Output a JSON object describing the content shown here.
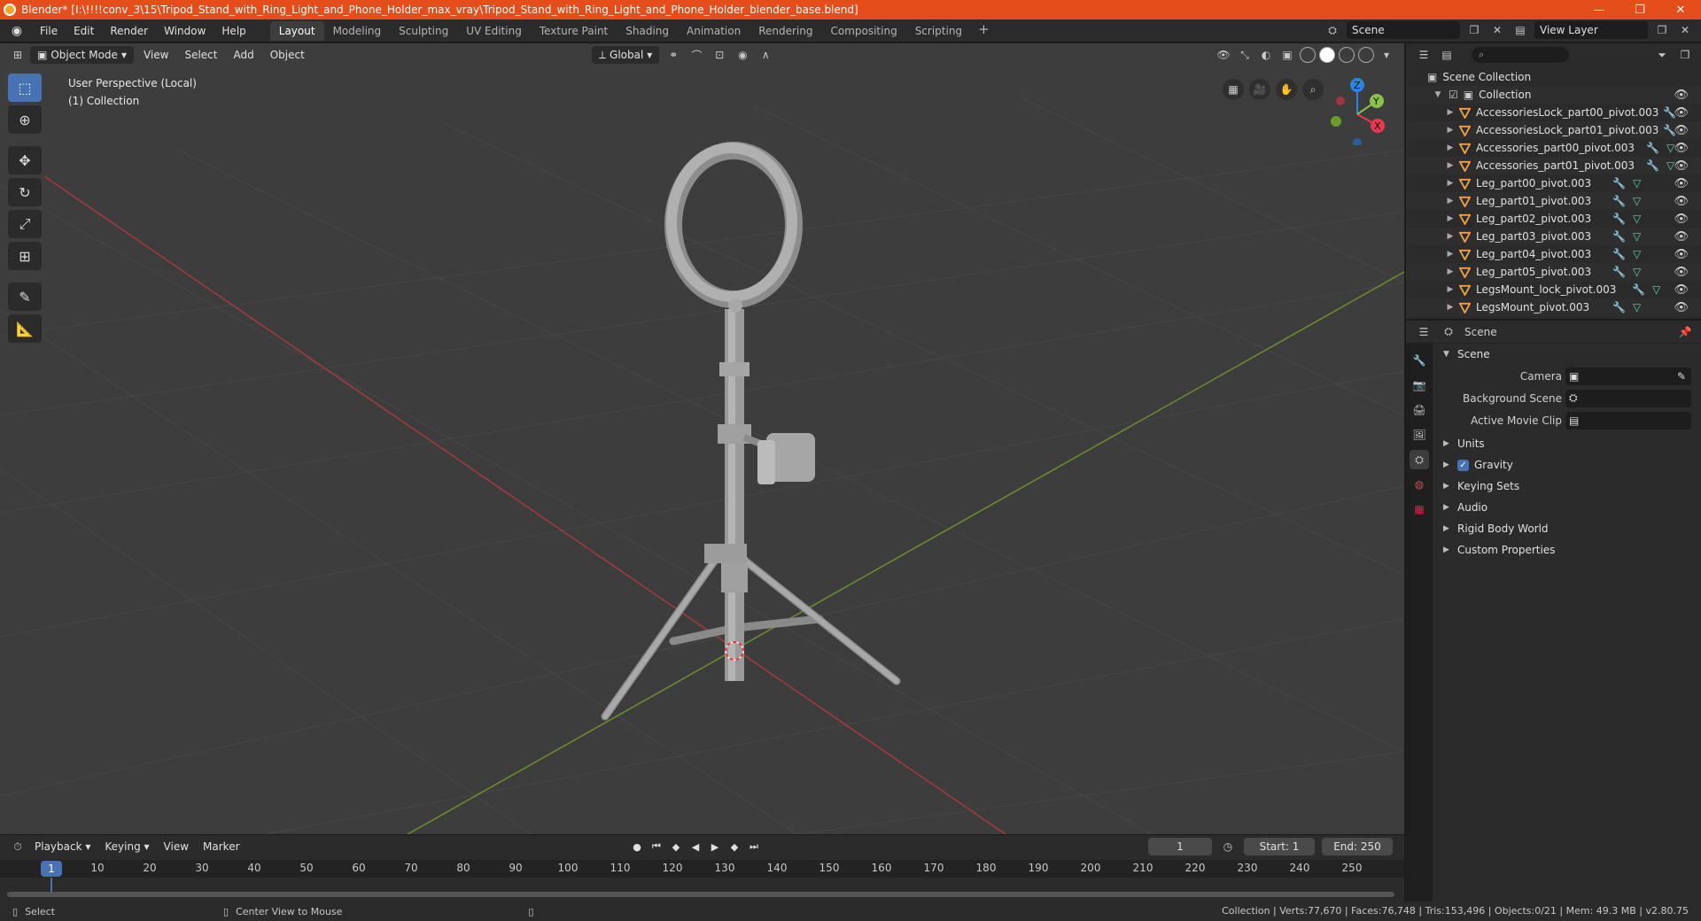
{
  "titlebar": {
    "title": "Blender* [I:\\!!!!conv_3\\15\\Tripod_Stand_with_Ring_Light_and_Phone_Holder_max_vray\\Tripod_Stand_with_Ring_Light_and_Phone_Holder_blender_base.blend]",
    "minimize": "—",
    "maximize": "❐",
    "close": "✕"
  },
  "menubar": {
    "menus": [
      "File",
      "Edit",
      "Render",
      "Window",
      "Help"
    ],
    "tabs": [
      "Layout",
      "Modeling",
      "Sculpting",
      "UV Editing",
      "Texture Paint",
      "Shading",
      "Animation",
      "Rendering",
      "Compositing",
      "Scripting"
    ],
    "tab_add": "+",
    "scene": "Scene",
    "view_layer": "View Layer"
  },
  "viewport": {
    "mode": "Object Mode",
    "menus": [
      "View",
      "Select",
      "Add",
      "Object"
    ],
    "orientation": "Global",
    "info_line1": "User Perspective (Local)",
    "info_line2": "(1) Collection",
    "gizmo": {
      "x": "X",
      "y": "Y",
      "z": "Z",
      "x_color": "#e8384f",
      "y_color": "#8bc34a",
      "z_color": "#2f83e0"
    }
  },
  "timeline": {
    "menus": [
      "Playback",
      "Keying",
      "View",
      "Marker"
    ],
    "current_frame": "1",
    "start_label": "Start:",
    "start": "1",
    "end_label": "End:",
    "end": "250",
    "ticks": [
      "10",
      "20",
      "30",
      "40",
      "50",
      "60",
      "70",
      "80",
      "90",
      "100",
      "110",
      "120",
      "130",
      "140",
      "150",
      "160",
      "170",
      "180",
      "190",
      "200",
      "210",
      "220",
      "230",
      "240",
      "250"
    ],
    "ruler_current": "1"
  },
  "statusbar": {
    "select": "Select",
    "center_view": "Center View to Mouse",
    "stats": "Collection | Verts:77,670 | Faces:76,748 | Tris:153,496 | Objects:0/21 | Mem: 49.3 MB | v2.80.75"
  },
  "outliner": {
    "search_placeholder": "⌕",
    "scene_collection": "Scene Collection",
    "collection": "Collection",
    "objects": [
      {
        "name": "AccessoriesLock_part00_pivot.003",
        "mesh": false
      },
      {
        "name": "AccessoriesLock_part01_pivot.003",
        "mesh": false
      },
      {
        "name": "Accessories_part00_pivot.003",
        "mesh": true
      },
      {
        "name": "Accessories_part01_pivot.003",
        "mesh": true
      },
      {
        "name": "Leg_part00_pivot.003",
        "mesh": true
      },
      {
        "name": "Leg_part01_pivot.003",
        "mesh": true
      },
      {
        "name": "Leg_part02_pivot.003",
        "mesh": true
      },
      {
        "name": "Leg_part03_pivot.003",
        "mesh": true
      },
      {
        "name": "Leg_part04_pivot.003",
        "mesh": true
      },
      {
        "name": "Leg_part05_pivot.003",
        "mesh": true
      },
      {
        "name": "LegsMount_lock_pivot.003",
        "mesh": true
      },
      {
        "name": "LegsMount_pivot.003",
        "mesh": true
      }
    ]
  },
  "properties": {
    "context": "Scene",
    "panel": "Scene",
    "camera_label": "Camera",
    "background_scene_label": "Background Scene",
    "active_movie_clip_label": "Active Movie Clip",
    "sections": [
      "Units",
      "Gravity",
      "Keying Sets",
      "Audio",
      "Rigid Body World",
      "Custom Properties"
    ]
  }
}
